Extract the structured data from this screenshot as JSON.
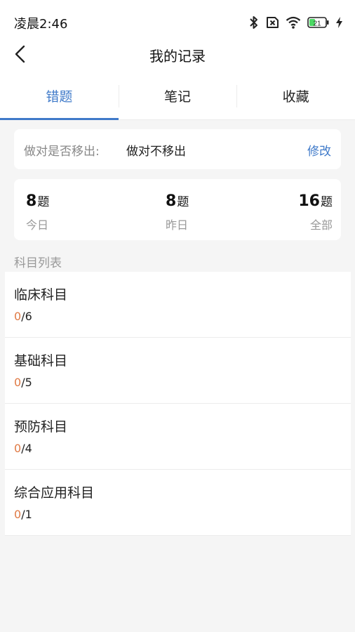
{
  "status_bar": {
    "time": "凌晨2:46",
    "battery": "21",
    "icons": [
      "bluetooth-icon",
      "sim-x-icon",
      "wifi-icon",
      "battery-icon",
      "charging-icon"
    ]
  },
  "header": {
    "title": "我的记录",
    "back_icon": "chevron-left-icon"
  },
  "tabs": [
    {
      "label": "错题",
      "active": true
    },
    {
      "label": "笔记",
      "active": false
    },
    {
      "label": "收藏",
      "active": false
    }
  ],
  "setting": {
    "label": "做对是否移出:",
    "value": "做对不移出",
    "edit": "修改"
  },
  "stats": [
    {
      "num": "8",
      "unit": "题",
      "label": "今日"
    },
    {
      "num": "8",
      "unit": "题",
      "label": "昨日"
    },
    {
      "num": "16",
      "unit": "题",
      "label": "全部"
    }
  ],
  "section_title": "科目列表",
  "subjects": [
    {
      "name": "临床科目",
      "done": "0",
      "total": "/6"
    },
    {
      "name": "基础科目",
      "done": "0",
      "total": "/5"
    },
    {
      "name": "预防科目",
      "done": "0",
      "total": "/4"
    },
    {
      "name": "综合应用科目",
      "done": "0",
      "total": "/1"
    }
  ],
  "colors": {
    "accent": "#3f7ac9",
    "progress_done": "#e07a45",
    "background": "#f5f5f5",
    "battery_fill": "#4cd964"
  }
}
